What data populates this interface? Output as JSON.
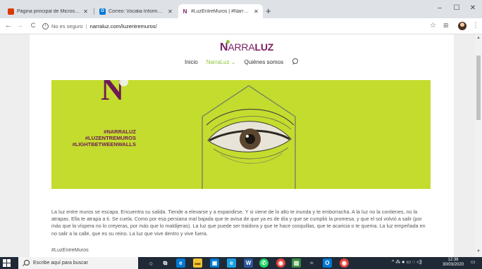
{
  "browser": {
    "tabs": [
      {
        "title": "Página principal de Microsoft Of",
        "favicon": "office",
        "favicon_color": "#d83b01",
        "active": false
      },
      {
        "title": "Correo: Vocalia Información Med",
        "favicon": "outlook",
        "favicon_color": "#0078d4",
        "active": false
      },
      {
        "title": "#LuzEntreMuros | #NarraLuz",
        "favicon": "narraluz",
        "favicon_color": "#7a1f63",
        "active": true
      }
    ],
    "new_tab": "+",
    "window_controls": {
      "minimize": "–",
      "maximize": "☐",
      "close": "✕"
    },
    "nav": {
      "back": "←",
      "forward": "→",
      "reload": "C"
    },
    "security": "No es seguro",
    "url": "narraluz.com/luzentremuros/",
    "toolbar_icons": {
      "bookmark": "☆",
      "extensions": "⊞",
      "menu": "⋮"
    }
  },
  "site": {
    "logo": {
      "n": "N",
      "arra": "ARRA",
      "luz": "LUZ"
    },
    "menu": [
      {
        "label": "Inicio",
        "active": false
      },
      {
        "label": "NarraLuz ⌄",
        "active": true
      },
      {
        "label": "Quiénes somos",
        "active": false
      }
    ],
    "hero": {
      "brand_letter": "N",
      "tags": [
        "#NARRALUZ",
        "#LUZENTREMUROS",
        "#LIGHTBETWEENWALLS"
      ],
      "bg_color": "#c4dc2e",
      "brand_color": "#6d1a55"
    },
    "body_text": "La luz entre muros se escapa. Encuentra su salida. Tiende a elevarse y a expandirse. Y si viene de lo alto te inunda y te emborracha. A la luz no la contienes, no la atrapas. Ella te atrapa a ti. Se cuela. Como por esa persiana mal bajada que te avisa de que ya es de día y que se cumplió la promesa, y que el sol volvió a salir (por más que la víspera no lo creyeras, por más que lo maldijeras). La luz que puede ser traidora y que te hace cosquillas, que te acaricia o te quema. La luz empeñada en no salir a la calle, que es su reino. La luz que vive dentro y vive fuera.",
    "hashtag": "#LuzEntreMuros"
  },
  "taskbar": {
    "search_placeholder": "Escribe aquí para buscar",
    "apps": [
      {
        "name": "cortana-icon",
        "glyph": "○",
        "color": "#1f2a36"
      },
      {
        "name": "task-view-icon",
        "glyph": "⧉",
        "color": "#1f2a36"
      },
      {
        "name": "edge-icon",
        "glyph": "e",
        "color": "#0078d4"
      },
      {
        "name": "file-explorer-icon",
        "glyph": "▬",
        "color": "#f1c232"
      },
      {
        "name": "store-icon",
        "glyph": "▣",
        "color": "#0078d4"
      },
      {
        "name": "ie-icon",
        "glyph": "e",
        "color": "#1ba1e2"
      },
      {
        "name": "word-icon",
        "glyph": "W",
        "color": "#2b579a"
      },
      {
        "name": "whatsapp-icon",
        "glyph": "✆",
        "color": "#25d366"
      },
      {
        "name": "chrome-icon",
        "glyph": "◉",
        "color": "#e8453c"
      },
      {
        "name": "photos-icon",
        "glyph": "▨",
        "color": "#3a8d3f"
      },
      {
        "name": "sketch-icon",
        "glyph": "≈",
        "color": "#1f2a36"
      },
      {
        "name": "outlook-icon",
        "glyph": "O",
        "color": "#0078d4"
      },
      {
        "name": "chrome-window-icon",
        "glyph": "◉",
        "color": "#e8453c"
      }
    ],
    "tray_icons": "^ ⁂ ● ▭ ◌ ◁)",
    "time": "12:38",
    "date": "30/03/2020",
    "notifications": "▭"
  }
}
